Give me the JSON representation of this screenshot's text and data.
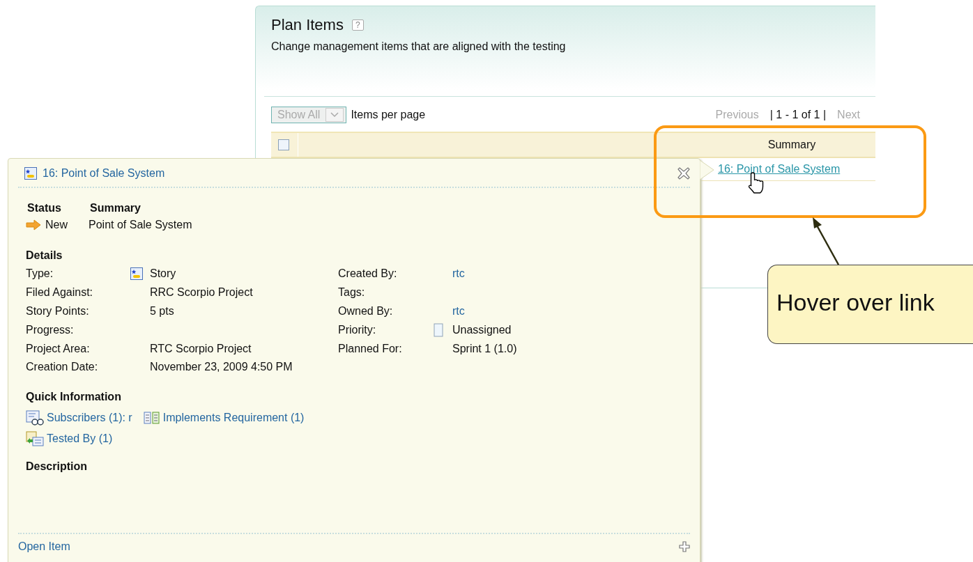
{
  "panel": {
    "title": "Plan Items",
    "help": "?",
    "description": "Change management items that are aligned with the testing",
    "page_size": {
      "value": "Show All",
      "disabled": true
    },
    "items_per_page_label": "Items per page",
    "pager": {
      "previous": {
        "label": "Previous",
        "disabled": true
      },
      "range": "| 1 - 1 of 1 |",
      "next": {
        "label": "Next",
        "disabled": true
      }
    },
    "table": {
      "select_all": {
        "checked": false
      },
      "columns": [
        "Summary"
      ],
      "rows": [
        {
          "summary": "16: Point of Sale System",
          "hovered": true
        }
      ]
    }
  },
  "popup": {
    "title": "16: Point of Sale System",
    "status_heading": "Status",
    "summary_heading": "Summary",
    "status": "New",
    "summary": "Point of Sale System",
    "details_heading": "Details",
    "details_left": [
      {
        "label": "Type:",
        "value": "Story",
        "kind": "type"
      },
      {
        "label": "Filed Against:",
        "value": "RRC Scorpio Project",
        "kind": "text"
      },
      {
        "label": "Story Points:",
        "value": "5 pts",
        "kind": "text"
      },
      {
        "label": "Progress:",
        "kind": "text"
      },
      {
        "label": "Project Area:",
        "value": "RTC Scorpio Project",
        "kind": "text"
      },
      {
        "label": "Creation Date:",
        "value": "November 23, 2009 4:50 PM",
        "kind": "text"
      }
    ],
    "details_right": [
      {
        "label": "Created By:",
        "value": "rtc",
        "kind": "link"
      },
      {
        "label": "Tags:",
        "kind": "text"
      },
      {
        "label": "Owned By:",
        "value": "rtc",
        "kind": "link"
      },
      {
        "label": "Priority:",
        "value": "Unassigned",
        "kind": "priority"
      },
      {
        "label": "Planned For:",
        "value": "Sprint 1 (1.0)",
        "kind": "text"
      }
    ],
    "quick_info_heading": "Quick Information",
    "quick_links": [
      {
        "label": "Subscribers (1): r",
        "kind": "subscribers"
      },
      {
        "label": "Implements Requirement (1)",
        "kind": "requirement"
      },
      {
        "label": "Tested By (1)",
        "kind": "tested"
      }
    ],
    "description_heading": "Description",
    "open_item": "Open Item"
  },
  "annotation": {
    "callout": "Hover over link"
  }
}
